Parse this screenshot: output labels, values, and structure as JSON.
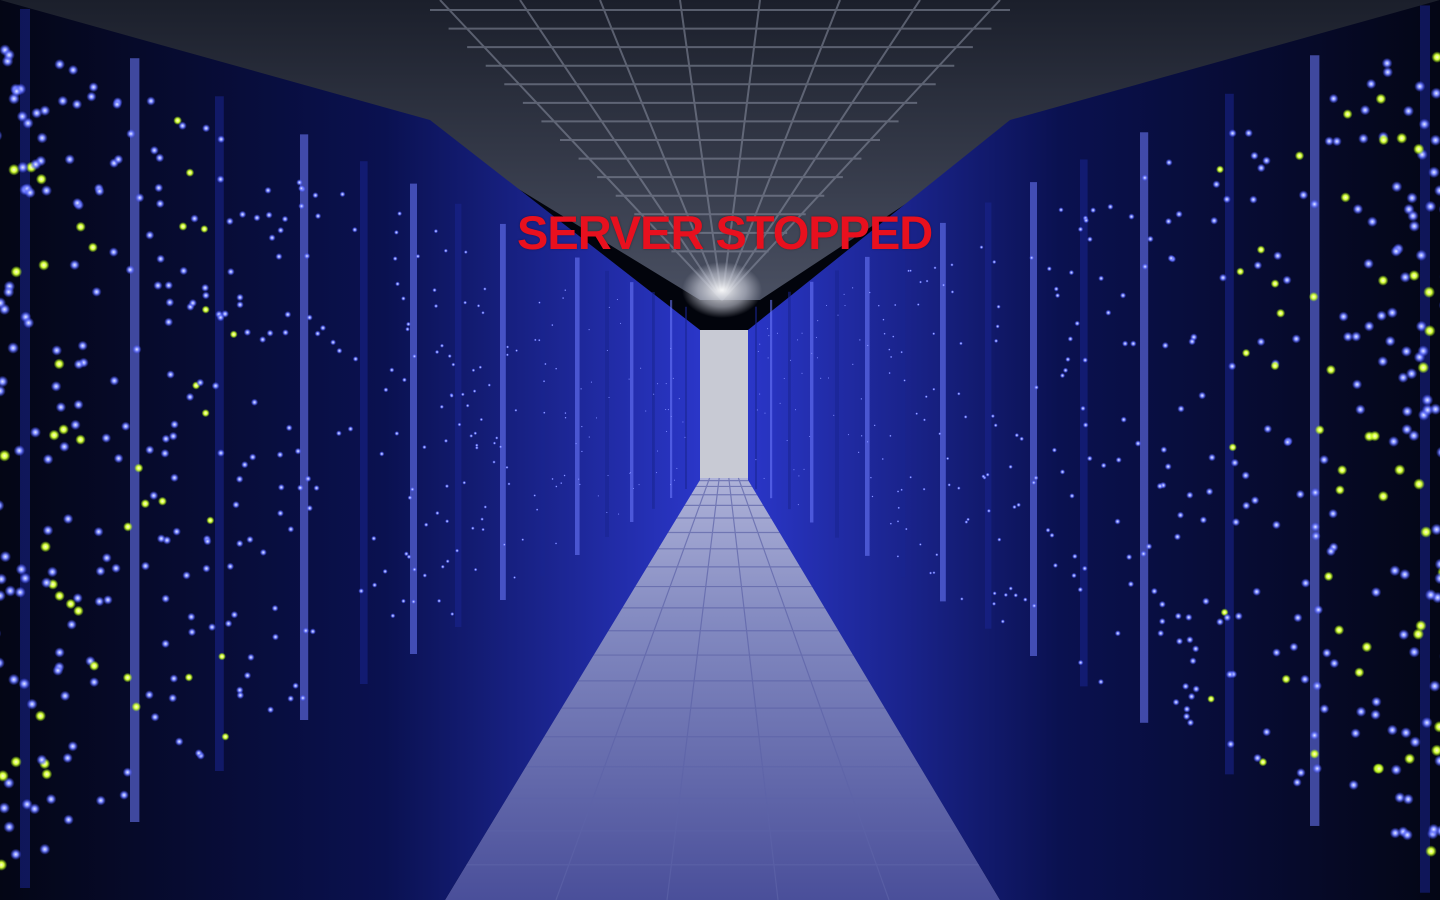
{
  "status_message": {
    "text": "SERVER STOPPED",
    "color": "#e8101e"
  },
  "palette": {
    "background": "#02040c",
    "led_blue": "#4a5cff",
    "led_blue_bright": "#9aa8ff",
    "led_yellow": "#d8ff3a",
    "floor": "#7f86b8",
    "ceiling": "#3a3f4e"
  }
}
